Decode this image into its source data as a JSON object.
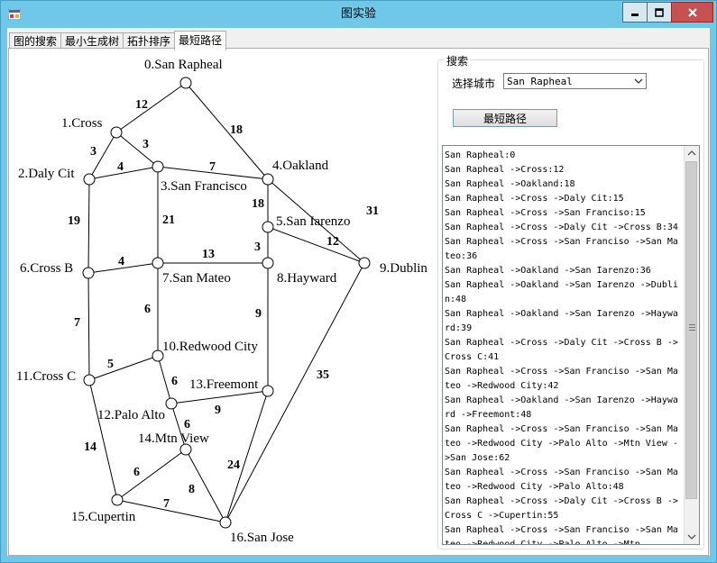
{
  "window": {
    "title": "图实验"
  },
  "tabs": [
    {
      "label": "图的搜索",
      "active": false
    },
    {
      "label": "最小生成树",
      "active": false
    },
    {
      "label": "拓扑排序",
      "active": false
    },
    {
      "label": "最短路径",
      "active": true
    }
  ],
  "graph": {
    "nodes": [
      {
        "label": "0.San Rapheal"
      },
      {
        "label": "1.Cross"
      },
      {
        "label": "2.Daly Cit"
      },
      {
        "label": "3.San Francisco"
      },
      {
        "label": "4.Oakland"
      },
      {
        "label": "5.San Iarenzo"
      },
      {
        "label": "6.Cross B"
      },
      {
        "label": "7.San Mateo"
      },
      {
        "label": "8.Hayward"
      },
      {
        "label": "9.Dublin"
      },
      {
        "label": "10.Redwood City"
      },
      {
        "label": "11.Cross C"
      },
      {
        "label": "12.Palo Alto"
      },
      {
        "label": "13.Freemont"
      },
      {
        "label": "14.Mtn View"
      },
      {
        "label": "15.Cupertin"
      },
      {
        "label": "16.San Jose"
      }
    ],
    "edges": [
      {
        "from": 0,
        "to": 1,
        "weight": "12"
      },
      {
        "from": 0,
        "to": 4,
        "weight": "18"
      },
      {
        "from": 1,
        "to": 2,
        "weight": "3"
      },
      {
        "from": 1,
        "to": 3,
        "weight": "3"
      },
      {
        "from": 2,
        "to": 3,
        "weight": "4"
      },
      {
        "from": 3,
        "to": 4,
        "weight": "7"
      },
      {
        "from": 2,
        "to": 6,
        "weight": "19"
      },
      {
        "from": 3,
        "to": 7,
        "weight": "21"
      },
      {
        "from": 4,
        "to": 5,
        "weight": "18"
      },
      {
        "from": 4,
        "to": 9,
        "weight": "31"
      },
      {
        "from": 5,
        "to": 9,
        "weight": "12"
      },
      {
        "from": 5,
        "to": 8,
        "weight": "3"
      },
      {
        "from": 6,
        "to": 7,
        "weight": "4"
      },
      {
        "from": 7,
        "to": 8,
        "weight": "13"
      },
      {
        "from": 6,
        "to": 11,
        "weight": "7"
      },
      {
        "from": 7,
        "to": 10,
        "weight": "6"
      },
      {
        "from": 8,
        "to": 13,
        "weight": "9"
      },
      {
        "from": 9,
        "to": 16,
        "weight": "35"
      },
      {
        "from": 11,
        "to": 10,
        "weight": "5"
      },
      {
        "from": 10,
        "to": 12,
        "weight": "6"
      },
      {
        "from": 12,
        "to": 13,
        "weight": "9"
      },
      {
        "from": 12,
        "to": 14,
        "weight": "6"
      },
      {
        "from": 11,
        "to": 15,
        "weight": "14"
      },
      {
        "from": 14,
        "to": 15,
        "weight": "6"
      },
      {
        "from": 14,
        "to": 16,
        "weight": "8"
      },
      {
        "from": 13,
        "to": 16,
        "weight": "24"
      },
      {
        "from": 15,
        "to": 16,
        "weight": "7"
      }
    ]
  },
  "search": {
    "group_title": "搜索",
    "city_label": "选择城市",
    "city_value": "San Rapheal",
    "button_label": "最短路径",
    "result_text": "San Rapheal:0\nSan Rapheal ->Cross:12\nSan Rapheal ->Oakland:18\nSan Rapheal ->Cross ->Daly Cit:15\nSan Rapheal ->Cross ->San Franciso:15\nSan Rapheal ->Cross ->Daly Cit ->Cross B:34\nSan Rapheal ->Cross ->San Franciso ->San Mateo:36\nSan Rapheal ->Oakland ->San Iarenzo:36\nSan Rapheal ->Oakland ->San Iarenzo ->Dublin:48\nSan Rapheal ->Oakland ->San Iarenzo ->Hayward:39\nSan Rapheal ->Cross ->Daly Cit ->Cross B ->Cross C:41\nSan Rapheal ->Cross ->San Franciso ->San Mateo ->Redwood City:42\nSan Rapheal ->Oakland ->San Iarenzo ->Hayward ->Freemont:48\nSan Rapheal ->Cross ->San Franciso ->San Mateo ->Redwood City ->Palo Alto ->Mtn View ->San Jose:62\nSan Rapheal ->Cross ->San Franciso ->San Mateo ->Redwood City ->Palo Alto:48\nSan Rapheal ->Cross ->Daly Cit ->Cross B ->Cross C ->Cupertin:55\nSan Rapheal ->Cross ->San Franciso ->San Mateo ->Redwood City ->Palo Alto ->Mtn"
  }
}
